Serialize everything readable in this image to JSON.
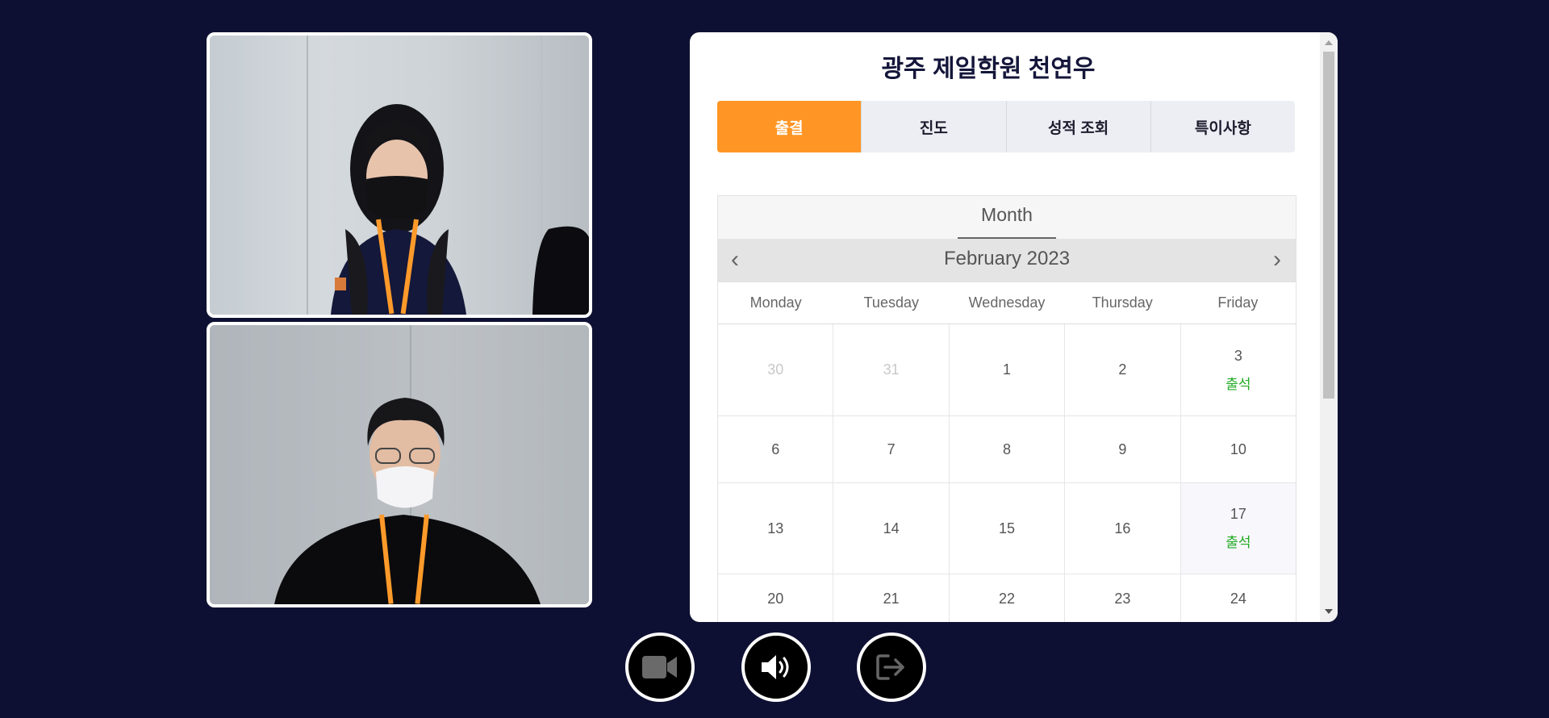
{
  "panel": {
    "title": "광주 제일학원 천연우",
    "tabs": [
      {
        "label": "출결",
        "active": true
      },
      {
        "label": "진도",
        "active": false
      },
      {
        "label": "성적 조회",
        "active": false
      },
      {
        "label": "특이사항",
        "active": false
      }
    ]
  },
  "calendar": {
    "view": "Month",
    "month_title": "February 2023",
    "days_of_week": [
      "Monday",
      "Tuesday",
      "Wednesday",
      "Thursday",
      "Friday"
    ],
    "weeks": [
      [
        {
          "d": "30",
          "o": true
        },
        {
          "d": "31",
          "o": true
        },
        {
          "d": "1"
        },
        {
          "d": "2"
        },
        {
          "d": "3",
          "s": "출석"
        }
      ],
      [
        {
          "d": "6"
        },
        {
          "d": "7"
        },
        {
          "d": "8"
        },
        {
          "d": "9"
        },
        {
          "d": "10"
        }
      ],
      [
        {
          "d": "13"
        },
        {
          "d": "14"
        },
        {
          "d": "15"
        },
        {
          "d": "16"
        },
        {
          "d": "17",
          "s": "출석",
          "hl": true
        }
      ],
      [
        {
          "d": "20"
        },
        {
          "d": "21"
        },
        {
          "d": "22"
        },
        {
          "d": "23"
        },
        {
          "d": "24"
        }
      ]
    ],
    "attendance_color": "#22aa22"
  },
  "controls": [
    {
      "name": "camera-button",
      "icon": "video-camera-icon"
    },
    {
      "name": "speaker-button",
      "icon": "speaker-icon"
    },
    {
      "name": "leave-button",
      "icon": "exit-icon"
    }
  ],
  "colors": {
    "background": "#0e1033",
    "accent": "#ff9524"
  }
}
